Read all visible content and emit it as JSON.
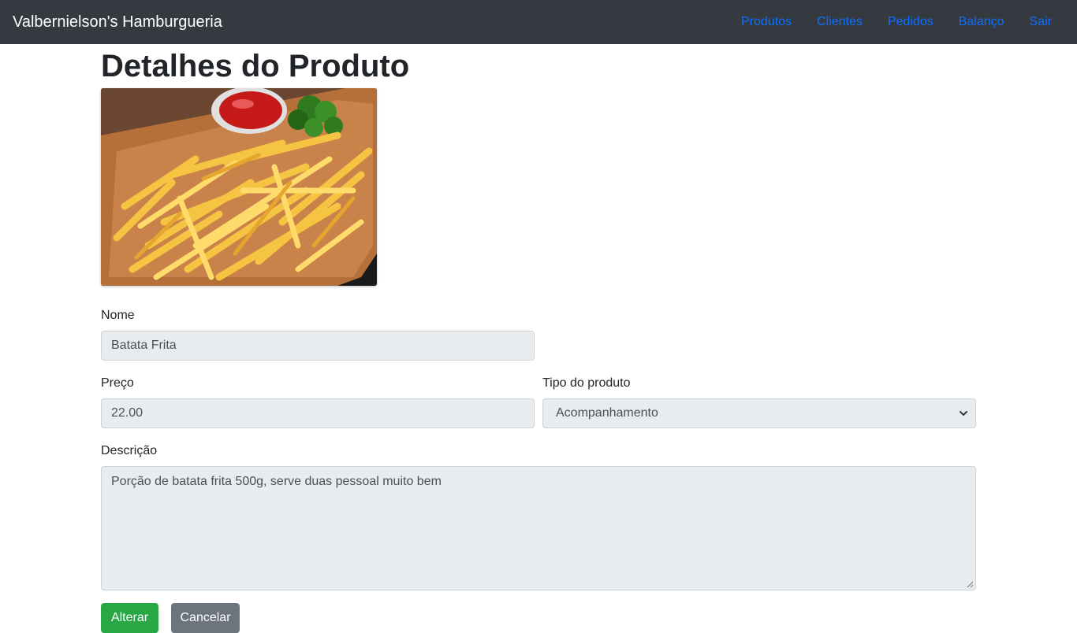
{
  "navbar": {
    "brand": "Valbernielson's Hamburgueria",
    "links": [
      "Produtos",
      "Clientes",
      "Pedidos",
      "Balanço",
      "Sair"
    ],
    "link_color": "#0d6efd",
    "background": "#343a40"
  },
  "page": {
    "title": "Detalhes do Produto"
  },
  "form": {
    "nome_label": "Nome",
    "nome_value": "Batata Frita",
    "preco_label": "Preço",
    "preco_value": "22.00",
    "tipo_label": "Tipo do produto",
    "tipo_value": "Acompanhamento",
    "descricao_label": "Descrição",
    "descricao_value": "Porção de batata frita 500g, serve duas pessoal muito bem"
  },
  "buttons": {
    "alterar_label": "Alterar",
    "alterar_color": "#28a745",
    "cancelar_label": "Cancelar",
    "cancelar_color": "#6c757d"
  }
}
